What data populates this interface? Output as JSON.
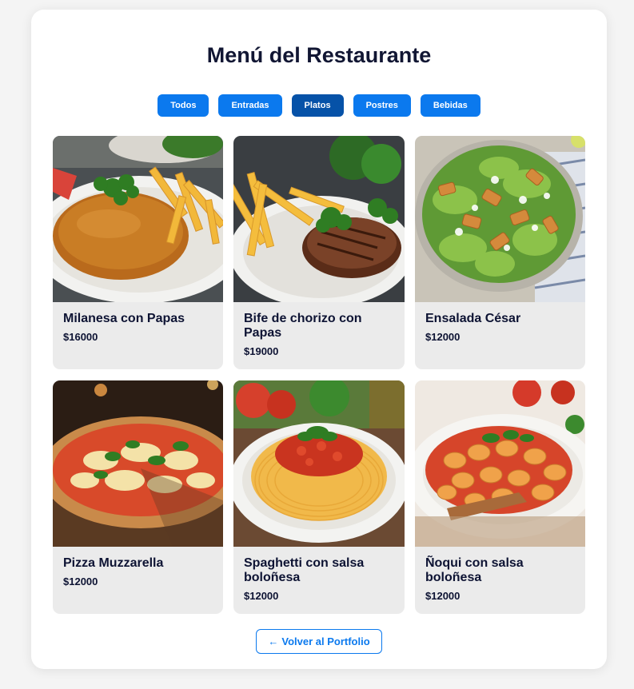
{
  "page": {
    "title": "Menú del Restaurante"
  },
  "filters": [
    {
      "label": "Todos",
      "active": false
    },
    {
      "label": "Entradas",
      "active": false
    },
    {
      "label": "Platos",
      "active": true
    },
    {
      "label": "Postres",
      "active": false
    },
    {
      "label": "Bebidas",
      "active": false
    }
  ],
  "dishes": [
    {
      "name": "Milanesa con Papas",
      "price": "$16000",
      "image": "milanesa-photo"
    },
    {
      "name": "Bife de chorizo con Papas",
      "price": "$19000",
      "image": "steak-photo"
    },
    {
      "name": "Ensalada César",
      "price": "$12000",
      "image": "caesar-salad-photo"
    },
    {
      "name": "Pizza Muzzarella",
      "price": "$12000",
      "image": "pizza-photo"
    },
    {
      "name": "Spaghetti con salsa boloñesa",
      "price": "$12000",
      "image": "spaghetti-photo"
    },
    {
      "name": "Ñoqui con salsa boloñesa",
      "price": "$12000",
      "image": "gnocchi-photo"
    }
  ],
  "footer": {
    "back_arrow": "←",
    "back_label": "Volver al Portfolio"
  },
  "colors": {
    "accent": "#0b79ee",
    "accent_active": "#0652a8",
    "card_bg": "#ebebeb"
  }
}
